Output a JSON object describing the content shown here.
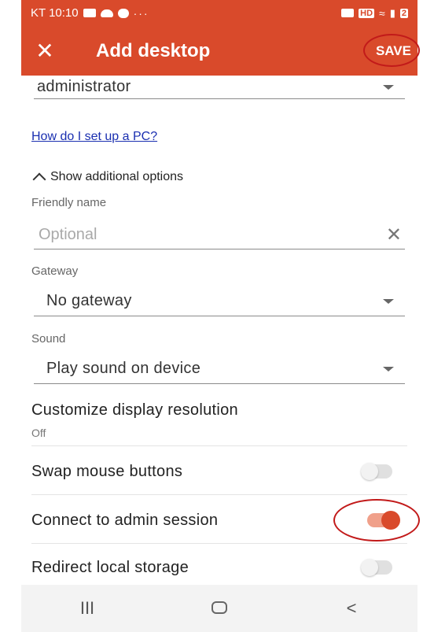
{
  "status_bar": {
    "carrier_time": "KT 10:10",
    "dots": "···",
    "hd_label": "HD",
    "battery_label": "2"
  },
  "app_bar": {
    "title": "Add desktop",
    "save_label": "SAVE"
  },
  "form": {
    "user_account_value": "administrator",
    "help_link": "How do I set up a PC?",
    "additional_options_label": "Show additional options",
    "friendly_name_label": "Friendly name",
    "friendly_name_placeholder": "Optional",
    "gateway_label": "Gateway",
    "gateway_value": "No gateway",
    "sound_label": "Sound",
    "sound_value": "Play sound on device",
    "display_resolution_label": "Customize display resolution",
    "display_resolution_value": "Off",
    "swap_mouse_label": "Swap mouse buttons",
    "swap_mouse_on": false,
    "admin_session_label": "Connect to admin session",
    "admin_session_on": true,
    "redirect_storage_label": "Redirect local storage",
    "redirect_storage_on": false
  },
  "nav_bar": {
    "recents": "III",
    "back": "<"
  },
  "colors": {
    "accent": "#d94a2b",
    "annotation_ring": "#c21a1a",
    "link": "#1a2fb0"
  }
}
